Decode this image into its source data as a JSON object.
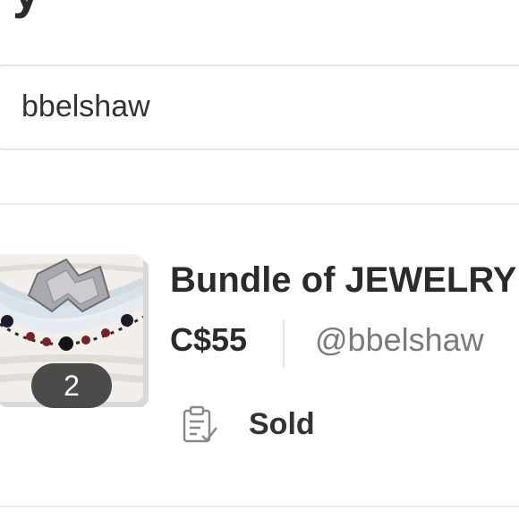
{
  "search": {
    "value": "bbelshaw"
  },
  "listing": {
    "title": "Bundle of JEWELRY",
    "price": "C$55",
    "seller": "@bbelshaw",
    "photo_count": "2",
    "status": "Sold",
    "status_icon": "clipboard-check-icon"
  },
  "colors": {
    "text": "#2b2b2b",
    "muted": "#7a7a7a",
    "badge_bg": "#4b4b4b",
    "divider": "#ececec"
  }
}
